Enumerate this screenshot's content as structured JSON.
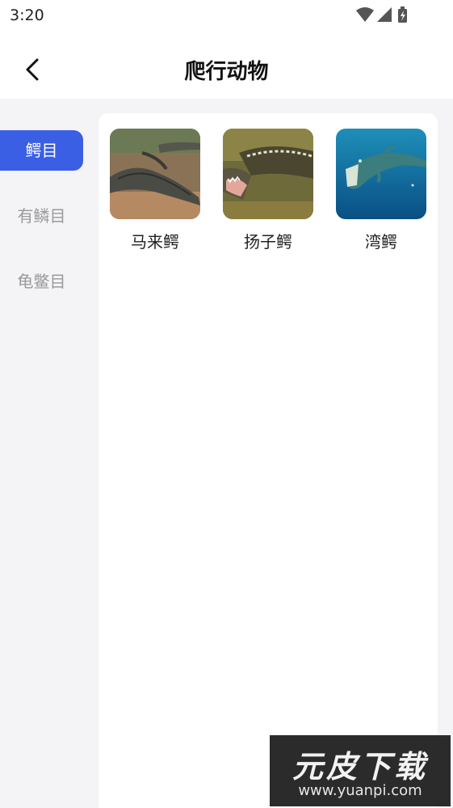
{
  "status_bar": {
    "time": "3:20",
    "icons": [
      "wifi-icon",
      "signal-icon",
      "battery-charging-icon"
    ]
  },
  "app_bar": {
    "back_icon": "chevron-left-icon",
    "title": "爬行动物"
  },
  "sidebar": {
    "items": [
      {
        "label": "鳄目",
        "selected": true
      },
      {
        "label": "有鳞目",
        "selected": false
      },
      {
        "label": "龟鳖目",
        "selected": false
      }
    ]
  },
  "grid": {
    "items": [
      {
        "label": "马来鳄"
      },
      {
        "label": "扬子鳄"
      },
      {
        "label": "湾鳄"
      }
    ]
  },
  "watermark": {
    "logo": "元皮下载",
    "url": "www.yuanpi.com"
  },
  "colors": {
    "accent": "#3a5fe5",
    "background": "#f4f4f7",
    "inactive_text": "#9a9a9a"
  }
}
